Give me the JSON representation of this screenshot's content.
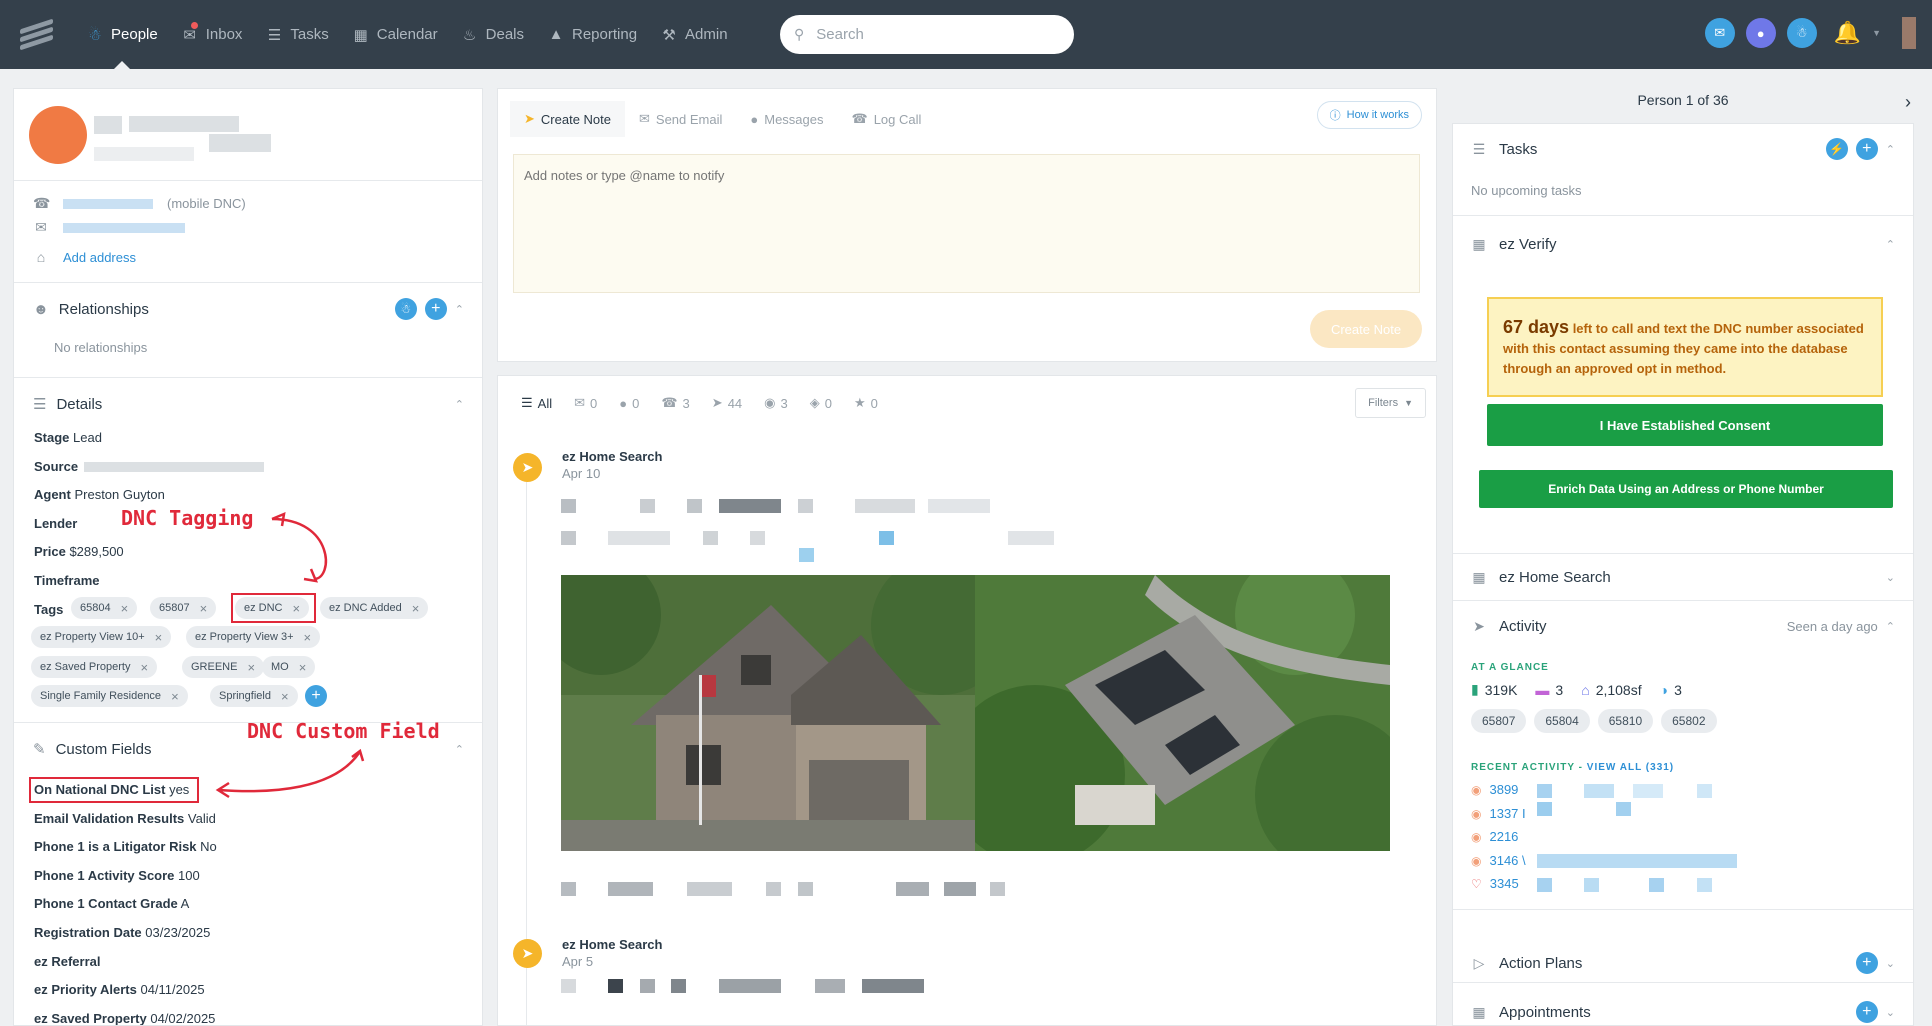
{
  "nav": {
    "items": [
      {
        "label": "People",
        "icon": "person-icon"
      },
      {
        "label": "Inbox",
        "icon": "inbox-icon"
      },
      {
        "label": "Tasks",
        "icon": "tasks-icon"
      },
      {
        "label": "Calendar",
        "icon": "calendar-icon"
      },
      {
        "label": "Deals",
        "icon": "deals-icon"
      },
      {
        "label": "Reporting",
        "icon": "reporting-icon"
      },
      {
        "label": "Admin",
        "icon": "admin-icon"
      }
    ],
    "active": "People",
    "search_placeholder": "Search"
  },
  "contact": {
    "phone_suffix": "(mobile DNC)",
    "add_address": "Add address"
  },
  "relationships": {
    "title": "Relationships",
    "empty": "No relationships"
  },
  "details": {
    "title": "Details",
    "stage_label": "Stage",
    "stage_value": "Lead",
    "source_label": "Source",
    "agent_label": "Agent",
    "agent_value": "Preston Guyton",
    "lender_label": "Lender",
    "price_label": "Price",
    "price_value": "$289,500",
    "timeframe_label": "Timeframe",
    "tags_label": "Tags",
    "tags": [
      "65804",
      "65807",
      "ez DNC",
      "ez DNC Added",
      "ez Property View 10+",
      "ez Property View 3+",
      "ez Saved Property",
      "GREENE",
      "MO",
      "Single Family Residence",
      "Springfield"
    ]
  },
  "annotations": {
    "dnc_tagging": "DNC Tagging",
    "dnc_custom_field": "DNC Custom Field"
  },
  "custom_fields": {
    "title": "Custom Fields",
    "rows": [
      {
        "label": "On National DNC List",
        "value": "yes"
      },
      {
        "label": "Email Validation Results",
        "value": "Valid"
      },
      {
        "label": "Phone 1 is a Litigator Risk",
        "value": "No"
      },
      {
        "label": "Phone 1 Activity Score",
        "value": "100"
      },
      {
        "label": "Phone 1 Contact Grade",
        "value": "A"
      },
      {
        "label": "Registration Date",
        "value": "03/23/2025"
      },
      {
        "label": "ez Referral",
        "value": ""
      },
      {
        "label": "ez Priority Alerts",
        "value": "04/11/2025"
      },
      {
        "label": "ez Saved Property",
        "value": "04/02/2025"
      }
    ]
  },
  "composer": {
    "tabs": [
      "Create Note",
      "Send Email",
      "Messages",
      "Log Call"
    ],
    "how_it_works": "How it works",
    "placeholder": "Add notes or type @name to notify",
    "create_button": "Create Note"
  },
  "feed": {
    "filter_tabs": [
      {
        "label": "All",
        "icon": "list-icon"
      },
      {
        "label": "0",
        "icon": "mail-icon"
      },
      {
        "label": "0",
        "icon": "chat-icon"
      },
      {
        "label": "3",
        "icon": "phone-icon"
      },
      {
        "label": "44",
        "icon": "pin-icon"
      },
      {
        "label": "3",
        "icon": "bubbles-icon"
      },
      {
        "label": "0",
        "icon": "drop-icon"
      },
      {
        "label": "0",
        "icon": "star-icon"
      }
    ],
    "filters_label": "Filters",
    "entries": [
      {
        "title": "ez Home Search",
        "date": "Apr 10"
      },
      {
        "title": "ez Home Search",
        "date": "Apr 5"
      }
    ]
  },
  "person_nav": {
    "label": "Person 1 of 36"
  },
  "tasks": {
    "title": "Tasks",
    "empty": "No upcoming tasks"
  },
  "ez_verify": {
    "title": "ez Verify",
    "days": "67 days",
    "message": "left to call and text the DNC number associated with this contact assuming they came into the database through an approved opt in method.",
    "consent_button": "I Have Established Consent",
    "enrich_button": "Enrich Data Using an Address or Phone Number"
  },
  "ez_home_search": {
    "title": "ez Home Search"
  },
  "activity": {
    "title": "Activity",
    "seen": "Seen a day ago",
    "glance_label": "AT A GLANCE",
    "stats": [
      {
        "value": "319K",
        "icon": "price-tag-icon"
      },
      {
        "value": "3",
        "icon": "bed-icon"
      },
      {
        "value": "2,108sf",
        "icon": "house-icon"
      },
      {
        "value": "3",
        "icon": "bath-icon"
      }
    ],
    "zips": [
      "65807",
      "65804",
      "65810",
      "65802"
    ],
    "recent_label": "RECENT ACTIVITY - ",
    "view_all": "VIEW ALL (331)",
    "recent": [
      "3899",
      "1337 I",
      "2216",
      "3146 \\",
      "3345"
    ]
  },
  "action_plans": {
    "title": "Action Plans"
  },
  "appointments": {
    "title": "Appointments"
  },
  "colors": {
    "nav_bg": "#34404b",
    "accent_blue": "#3fa2e0",
    "green": "#1a9e45",
    "annotation_red": "#e0293a",
    "note_yellow": "#fdf3c2"
  }
}
